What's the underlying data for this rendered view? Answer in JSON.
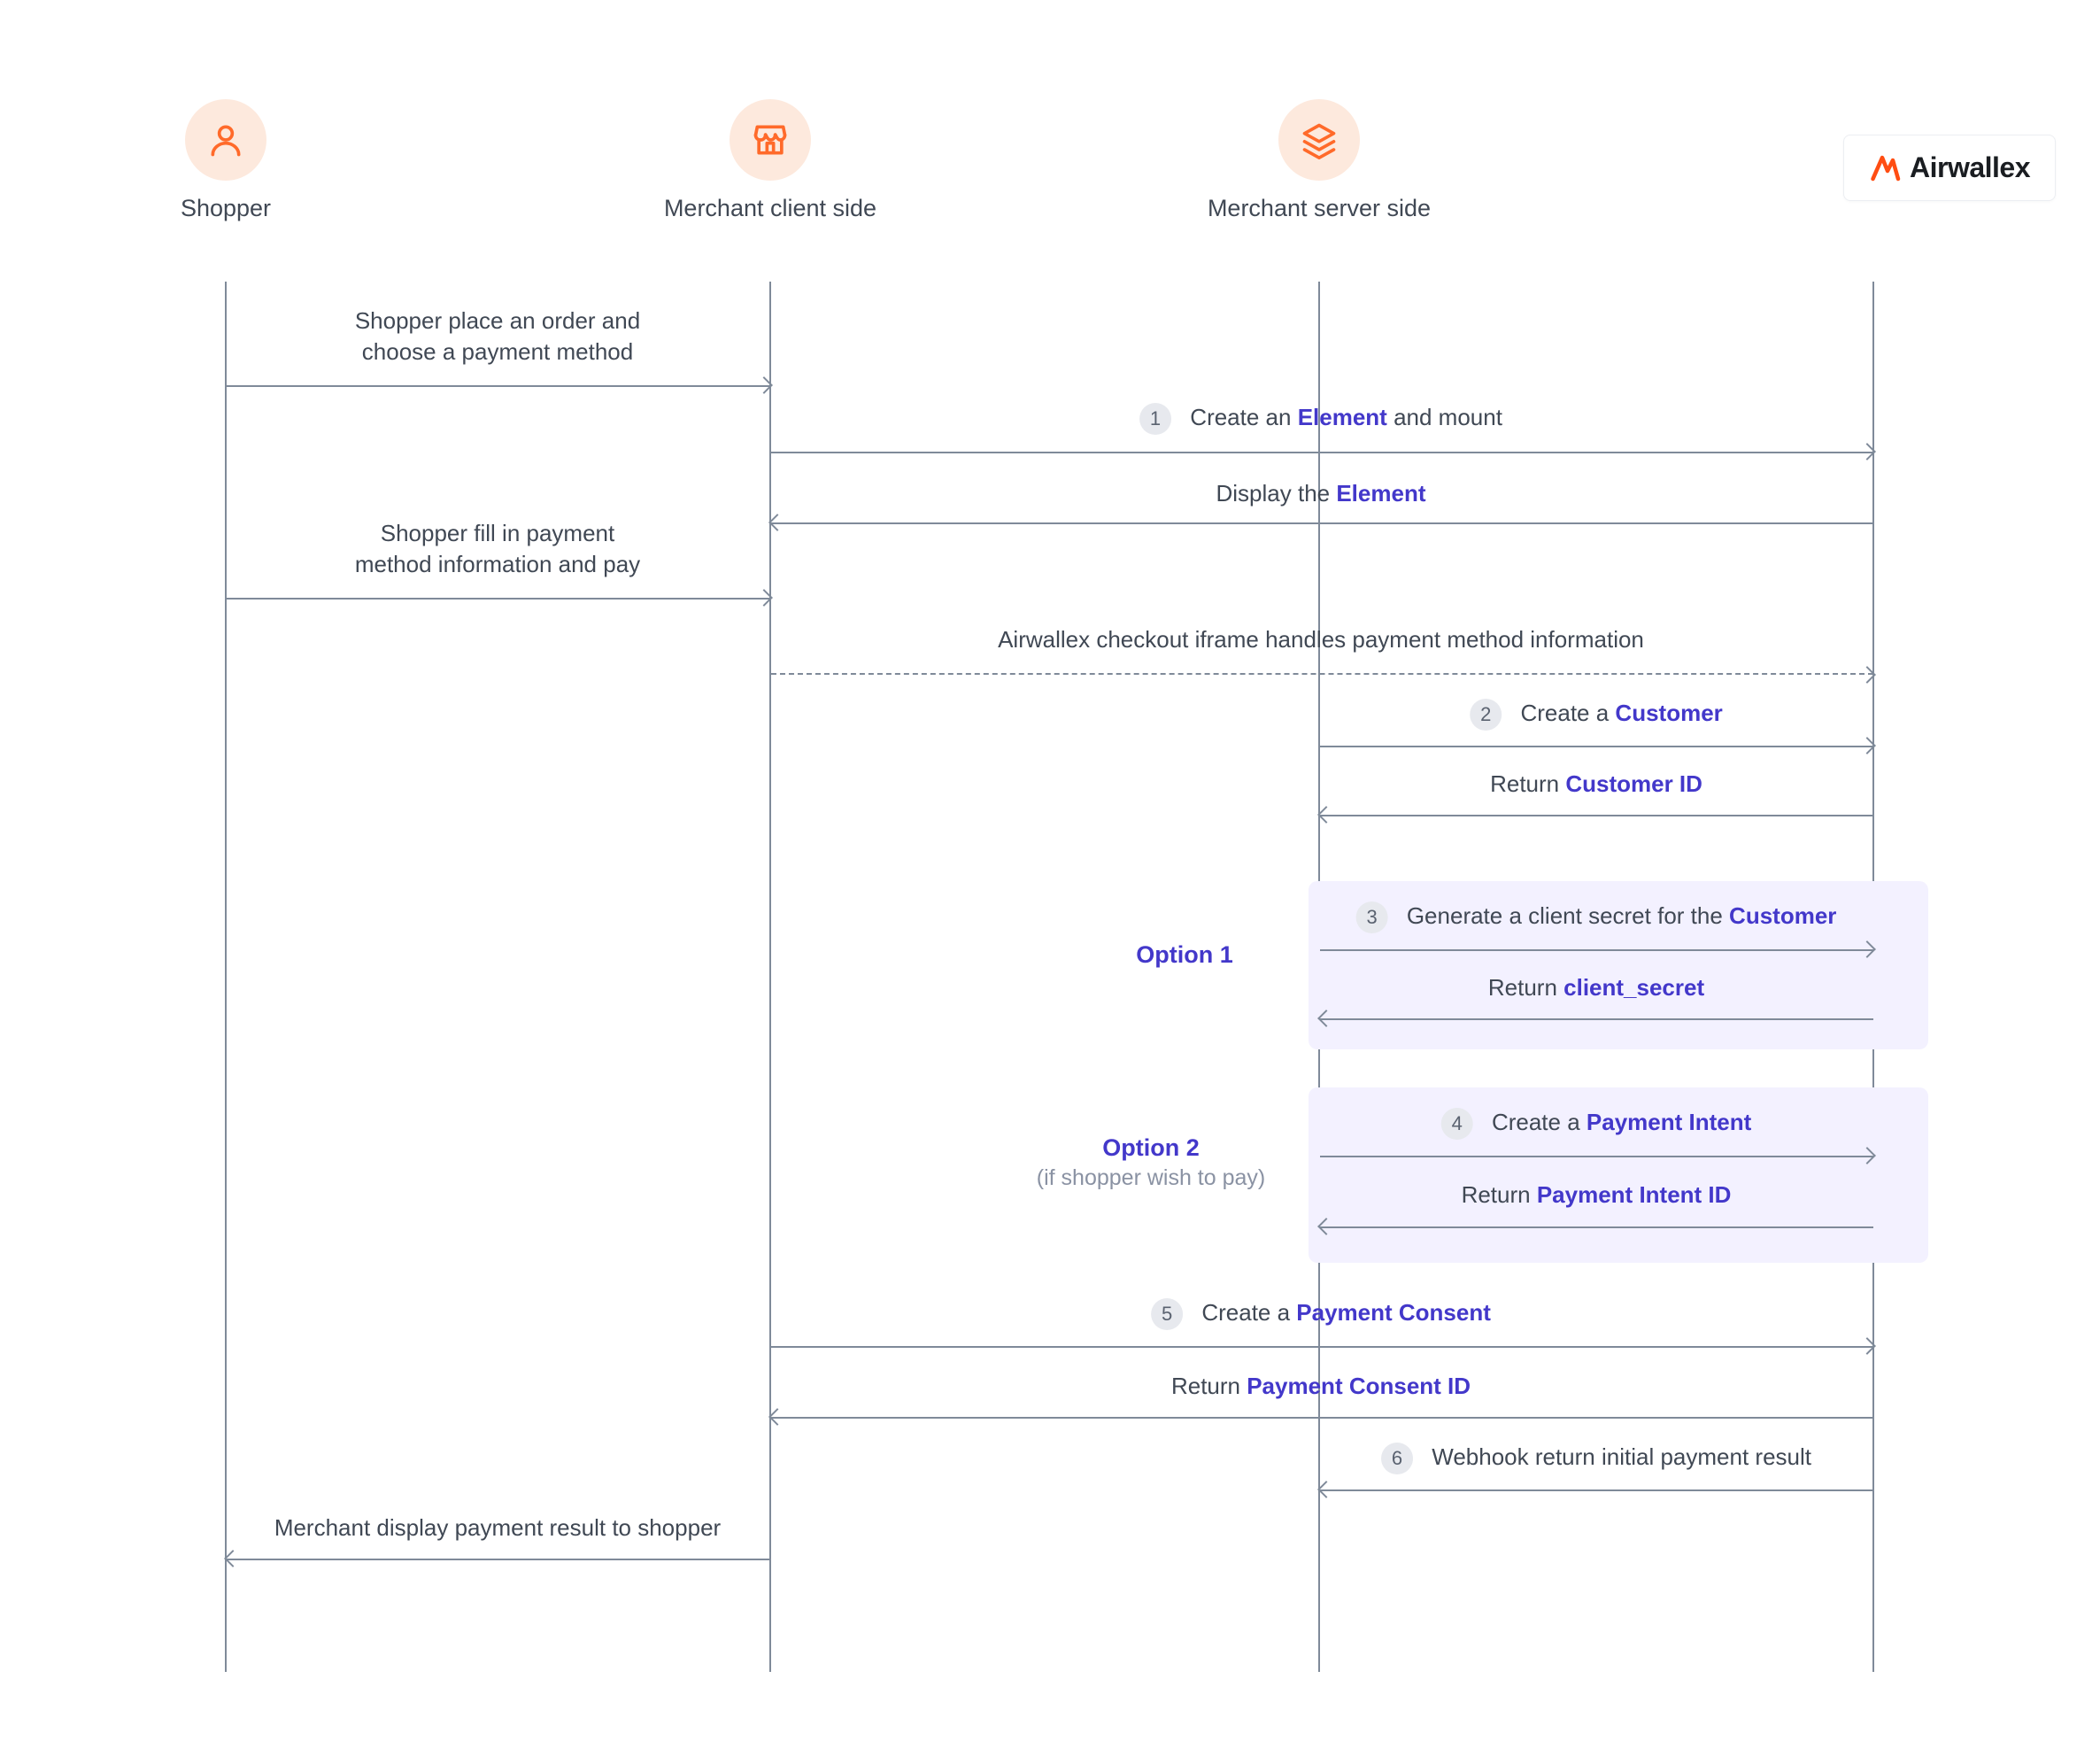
{
  "brand": {
    "name": "Airwallex",
    "accent": "#ff6a2a",
    "link_color": "#4338ca"
  },
  "actors": {
    "shopper": {
      "label": "Shopper",
      "icon": "user-icon"
    },
    "client": {
      "label": "Merchant client side",
      "icon": "store-icon"
    },
    "server": {
      "label": "Merchant server side",
      "icon": "stack-icon"
    },
    "airwallex": {
      "label": "Airwallex"
    }
  },
  "messages": {
    "m01": {
      "text_pre": "Shopper place an order and\nchoose a payment method"
    },
    "m02": {
      "step": "1",
      "text_pre": "Create an ",
      "link": "Element",
      "text_post": " and mount"
    },
    "m03": {
      "text_pre": "Display the ",
      "link": "Element"
    },
    "m04": {
      "text_pre": "Shopper fill in payment\nmethod information and pay"
    },
    "m05": {
      "text_pre": "Airwallex checkout iframe handles payment method information"
    },
    "m06": {
      "step": "2",
      "text_pre": "Create a ",
      "link": "Customer"
    },
    "m07": {
      "text_pre": "Return ",
      "link": "Customer ID"
    },
    "opt1": {
      "title": "Option 1"
    },
    "m08": {
      "step": "3",
      "text_pre": "Generate a client secret for the ",
      "link": "Customer"
    },
    "m09": {
      "text_pre": "Return ",
      "link": "client_secret"
    },
    "opt2": {
      "title": "Option 2",
      "sub": "(if shopper wish to pay)"
    },
    "m10": {
      "step": "4",
      "text_pre": "Create a ",
      "link": "Payment Intent"
    },
    "m11": {
      "text_pre": "Return ",
      "link": "Payment Intent ID"
    },
    "m12": {
      "step": "5",
      "text_pre": "Create a ",
      "link": "Payment Consent"
    },
    "m13": {
      "text_pre": "Return ",
      "link": "Payment Consent ID"
    },
    "m14": {
      "step": "6",
      "text_pre": "Webhook return initial payment result"
    },
    "m15": {
      "text_pre": "Merchant display payment result to shopper"
    }
  }
}
